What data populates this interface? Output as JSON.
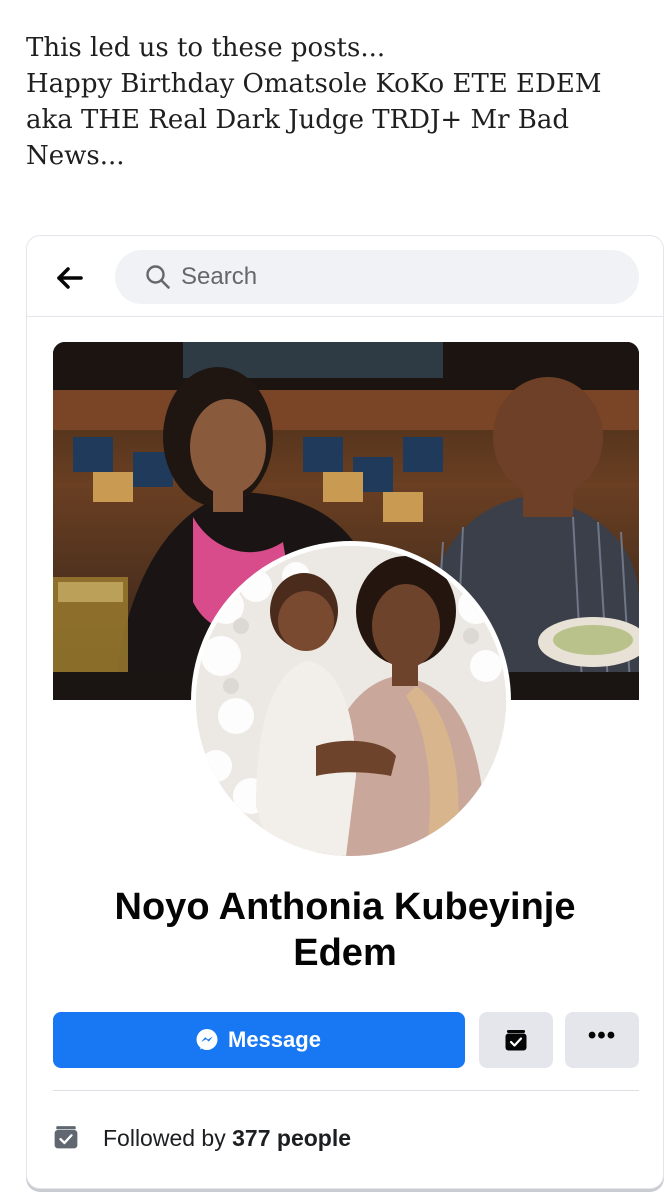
{
  "intro": {
    "lines": [
      "This led us to these posts...",
      "Happy Birthday Omatsole KoKo ETE EDEM",
      "aka THE Real Dark Judge TRDJ+ Mr Bad",
      "News..."
    ]
  },
  "topbar": {
    "back_icon": "arrow-left-icon",
    "search_icon": "search-icon",
    "search_placeholder": "Search"
  },
  "profile": {
    "name_line1": "Noyo Anthonia Kubeyinje",
    "name_line2": "Edem",
    "cover_photo": "couple-at-restaurant-photo",
    "profile_photo": "woman-holding-baby-photo"
  },
  "actions": {
    "message_label": "Message",
    "message_icon": "messenger-icon",
    "follow_icon": "following-check-icon",
    "more_label": "•••"
  },
  "followers": {
    "prefix": "Followed by",
    "count_text": "377 people",
    "icon": "following-check-icon"
  },
  "colors": {
    "accent": "#1877f2",
    "secondary_button": "#e4e6eb",
    "search_bg": "#f0f2f5"
  }
}
